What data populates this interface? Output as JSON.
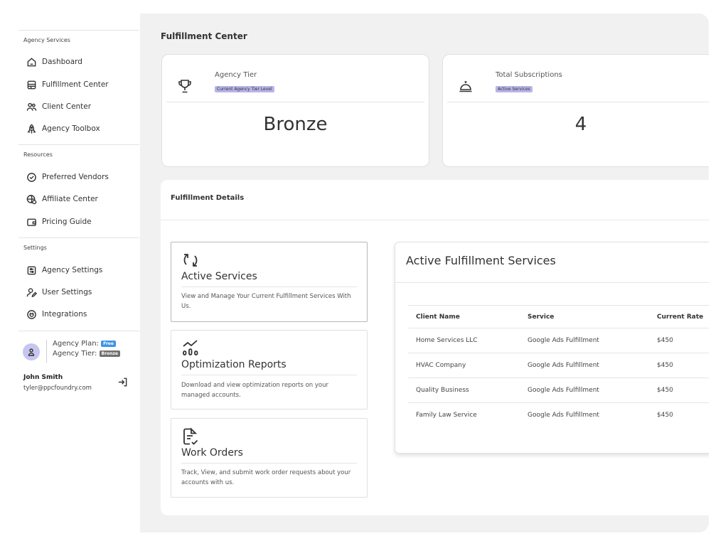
{
  "sidebar": {
    "sections": [
      {
        "title": "Agency Services",
        "items": [
          {
            "label": "Dashboard",
            "icon": "home-icon"
          },
          {
            "label": "Fulfillment Center",
            "icon": "inbox-icon"
          },
          {
            "label": "Client Center",
            "icon": "users-icon"
          },
          {
            "label": "Agency Toolbox",
            "icon": "rocket-icon"
          }
        ]
      },
      {
        "title": "Resources",
        "items": [
          {
            "label": "Preferred Vendors",
            "icon": "shield-check-icon"
          },
          {
            "label": "Affiliate Center",
            "icon": "globe-dollar-icon"
          },
          {
            "label": "Pricing Guide",
            "icon": "wallet-icon"
          }
        ]
      },
      {
        "title": "Settings",
        "items": [
          {
            "label": "Agency Settings",
            "icon": "settings-panel-icon"
          },
          {
            "label": "User Settings",
            "icon": "user-edit-icon"
          },
          {
            "label": "Integrations",
            "icon": "plug-icon"
          }
        ]
      }
    ],
    "user": {
      "plan_label": "Agency Plan:",
      "plan_badge": "Free",
      "tier_label": "Agency Tier:",
      "tier_badge": "Bronze",
      "name": "John Smith",
      "email": "tyler@ppcfoundry.com"
    }
  },
  "main": {
    "title": "Fulfillment Center",
    "stats": [
      {
        "label": "Agency Tier",
        "pill": "Current Agency Tier Level",
        "value": "Bronze",
        "icon": "trophy-icon"
      },
      {
        "label": "Total Subscriptions",
        "pill": "Active Services",
        "value": "4",
        "icon": "service-bell-icon"
      }
    ],
    "details": {
      "title": "Fulfillment Details",
      "features": [
        {
          "title": "Active Services",
          "description": "View and Manage Your Current Fulfillment Services With Us.",
          "icon": "refresh-icon"
        },
        {
          "title": "Optimization Reports",
          "description": "Download and view optimization reports on your managed accounts.",
          "icon": "chart-trend-icon"
        },
        {
          "title": "Work Orders",
          "description": "Track, View, and submit work order requests about your accounts with us.",
          "icon": "document-check-icon"
        }
      ],
      "services": {
        "title": "Active Fulfillment Services",
        "columns": [
          "Client Name",
          "Service",
          "Current Rate"
        ],
        "rows": [
          [
            "Home Services LLC",
            "Google Ads Fulfillment",
            "$450"
          ],
          [
            "HVAC Company",
            "Google Ads Fulfillment",
            "$450"
          ],
          [
            "Quality Business",
            "Google Ads Fulfillment",
            "$450"
          ],
          [
            "Family Law Service",
            "Google Ads Fulfillment",
            "$450"
          ]
        ]
      }
    }
  },
  "colors": {
    "pill": "#b7b5e8",
    "avatar": "#c8c6f0",
    "badge_free": "#3d94e8",
    "badge_bronze": "#707070",
    "main_bg": "#f1f1f1"
  }
}
